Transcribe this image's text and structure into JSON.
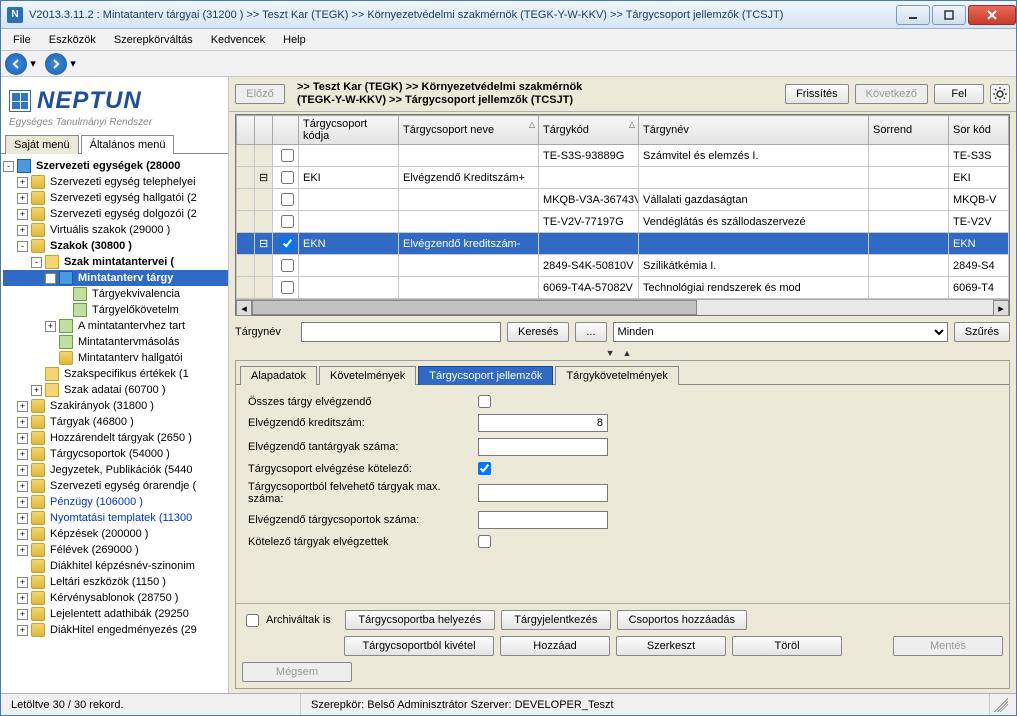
{
  "window": {
    "title": "V2013.3.11.2 : Mintatanterv tárgyai (31200  )  >> Teszt Kar (TEGK) >> Környezetvédelmi szakmérnök (TEGK-Y-W-KKV) >> Tárgycsoport jellemzők (TCSJT)"
  },
  "menu": {
    "items": [
      "File",
      "Eszközök",
      "Szerepkörváltás",
      "Kedvencek",
      "Help"
    ]
  },
  "logo": {
    "brand": "NEPTUN",
    "sub": "Egységes Tanulmányi Rendszer"
  },
  "left_tabs": {
    "items": [
      "Saját menü",
      "Általános menü"
    ],
    "active": 1
  },
  "tree": [
    {
      "depth": 0,
      "exp": "-",
      "icon": "blue",
      "label": "Szervezeti egységek (28000",
      "bold": true
    },
    {
      "depth": 1,
      "exp": "+",
      "icon": "db",
      "label": "Szervezeti egység telephelyei"
    },
    {
      "depth": 1,
      "exp": "+",
      "icon": "db",
      "label": "Szervezeti egység hallgatói (2"
    },
    {
      "depth": 1,
      "exp": "+",
      "icon": "db",
      "label": "Szervezeti egység dolgozói (2"
    },
    {
      "depth": 1,
      "exp": "+",
      "icon": "db",
      "label": "Virtuális szakok (29000  )"
    },
    {
      "depth": 1,
      "exp": "-",
      "icon": "db",
      "label": "Szakok (30800  )",
      "bold": true
    },
    {
      "depth": 2,
      "exp": "-",
      "icon": "folder",
      "label": "Szak mintatantervei (",
      "bold": true
    },
    {
      "depth": 3,
      "exp": "-",
      "icon": "blue",
      "label": "Mintatanterv tárgy",
      "sel": true,
      "bold": true
    },
    {
      "depth": 4,
      "exp": "",
      "icon": "form",
      "label": "Tárgyekvivalencia"
    },
    {
      "depth": 4,
      "exp": "",
      "icon": "form",
      "label": "Tárgyelőkövetelm"
    },
    {
      "depth": 3,
      "exp": "+",
      "icon": "form",
      "label": "A mintatantervhez tart"
    },
    {
      "depth": 3,
      "exp": "",
      "icon": "form",
      "label": "Mintatantervmásolás"
    },
    {
      "depth": 3,
      "exp": "",
      "icon": "db",
      "label": "Mintatanterv hallgatói"
    },
    {
      "depth": 2,
      "exp": "",
      "icon": "folder",
      "label": "Szakspecifikus értékek (1"
    },
    {
      "depth": 2,
      "exp": "+",
      "icon": "folder",
      "label": "Szak adatai (60700  )"
    },
    {
      "depth": 1,
      "exp": "+",
      "icon": "db",
      "label": "Szakirányok (31800  )"
    },
    {
      "depth": 1,
      "exp": "+",
      "icon": "db",
      "label": "Tárgyak (46800  )"
    },
    {
      "depth": 1,
      "exp": "+",
      "icon": "db",
      "label": "Hozzárendelt tárgyak (2650  )"
    },
    {
      "depth": 1,
      "exp": "+",
      "icon": "db",
      "label": "Tárgycsoportok (54000  )"
    },
    {
      "depth": 1,
      "exp": "+",
      "icon": "db",
      "label": "Jegyzetek, Publikációk (5440"
    },
    {
      "depth": 1,
      "exp": "+",
      "icon": "db",
      "label": "Szervezeti egység órarendje ("
    },
    {
      "depth": 1,
      "exp": "+",
      "icon": "db",
      "label": "Pénzügy (106000  )",
      "link": true
    },
    {
      "depth": 1,
      "exp": "+",
      "icon": "db",
      "label": "Nyomtatási templatek (11300",
      "link": true
    },
    {
      "depth": 1,
      "exp": "+",
      "icon": "db",
      "label": "Képzések (200000  )"
    },
    {
      "depth": 1,
      "exp": "+",
      "icon": "db",
      "label": "Félévek (269000  )"
    },
    {
      "depth": 1,
      "exp": "",
      "icon": "db",
      "label": "Diákhitel képzésnév-szinonim"
    },
    {
      "depth": 1,
      "exp": "+",
      "icon": "db",
      "label": "Leltári eszközök (1150  )"
    },
    {
      "depth": 1,
      "exp": "+",
      "icon": "db",
      "label": "Kérvénysablonok (28750  )"
    },
    {
      "depth": 1,
      "exp": "+",
      "icon": "db",
      "label": "Lejelentett adathibák (29250"
    },
    {
      "depth": 1,
      "exp": "+",
      "icon": "db",
      "label": "DiákHitel engedményezés (29"
    }
  ],
  "toolbar": {
    "prev": "Előző",
    "next": "Következő",
    "refresh": "Frissítés",
    "up": "Fel",
    "breadcrumb_l1": ">> Teszt Kar (TEGK) >> Környezetvédelmi szakmérnök",
    "breadcrumb_l2": "(TEGK-Y-W-KKV) >> Tárgycsoport jellemzők (TCSJT)"
  },
  "grid": {
    "cols": [
      "",
      "",
      "Tárgycsoport kódja",
      "Tárgycsoport neve",
      "Tárgykód",
      "Tárgynév",
      "Sorrend",
      "Sor kód"
    ],
    "rows": [
      {
        "exp": "",
        "chk": false,
        "cells": [
          "",
          "",
          "TE-S3S-93889G",
          "Számvitel és elemzés I.",
          "",
          "TE-S3S"
        ]
      },
      {
        "exp": "-",
        "chk": false,
        "cells": [
          "EKI",
          "Elvégzendő Kreditszám+",
          "",
          "",
          "",
          "EKI"
        ]
      },
      {
        "exp": "",
        "chk": false,
        "cells": [
          "",
          "",
          "MKQB-V3A-36743V",
          "Vállalati gazdaságtan",
          "",
          "MKQB-V"
        ]
      },
      {
        "exp": "",
        "chk": false,
        "cells": [
          "",
          "",
          "TE-V2V-77197G",
          "Vendéglátás és szállodaszervezé",
          "",
          "TE-V2V"
        ]
      },
      {
        "exp": "-",
        "chk": true,
        "sel": true,
        "cells": [
          "EKN",
          "Elvégzendő kreditszám-",
          "",
          "",
          "",
          "EKN"
        ]
      },
      {
        "exp": "",
        "chk": false,
        "cells": [
          "",
          "",
          "2849-S4K-50810V",
          "Szilikátkémia I.",
          "",
          "2849-S4"
        ]
      },
      {
        "exp": "",
        "chk": false,
        "cells": [
          "",
          "",
          "6069-T4A-57082V",
          "Technológiai rendszerek és mod",
          "",
          "6069-T4"
        ]
      }
    ]
  },
  "search": {
    "label": "Tárgynév",
    "value": "",
    "search_btn": "Keresés",
    "dots": "...",
    "filter_value": "Minden",
    "filter_btn": "Szűrés"
  },
  "detail_tabs": {
    "items": [
      "Alapadatok",
      "Követelmények",
      "Tárgycsoport jellemzők",
      "Tárgykövetelmények"
    ],
    "active": 2
  },
  "form": {
    "f1_label": "Összes tárgy elvégzendő",
    "f1_checked": false,
    "f2_label": "Elvégzendő kreditszám:",
    "f2_value": "8",
    "f3_label": "Elvégzendő tantárgyak száma:",
    "f3_value": "",
    "f4_label": "Tárgycsoport elvégzése kötelező:",
    "f4_checked": true,
    "f5_label": "Tárgycsoportból felvehető tárgyak max. száma:",
    "f5_value": "",
    "f6_label": "Elvégzendő tárgycsoportok száma:",
    "f6_value": "",
    "f7_label": "Kötelező tárgyak elvégzettek",
    "f7_checked": false
  },
  "actions": {
    "arch": "Archiváltak is",
    "b1": "Tárgycsoportba helyezés",
    "b2": "Tárgyjelentkezés",
    "b3": "Csoportos hozzáadás",
    "b4": "Tárgycsoportból kivétel",
    "b5": "Hozzáad",
    "b6": "Szerkeszt",
    "b7": "Töröl",
    "b8": "Mentés",
    "b9": "Mégsem"
  },
  "status": {
    "left": "Letöltve 30 / 30 rekord.",
    "mid": "Szerepkör: Belső Adminisztrátor    Szerver: DEVELOPER_Teszt"
  }
}
